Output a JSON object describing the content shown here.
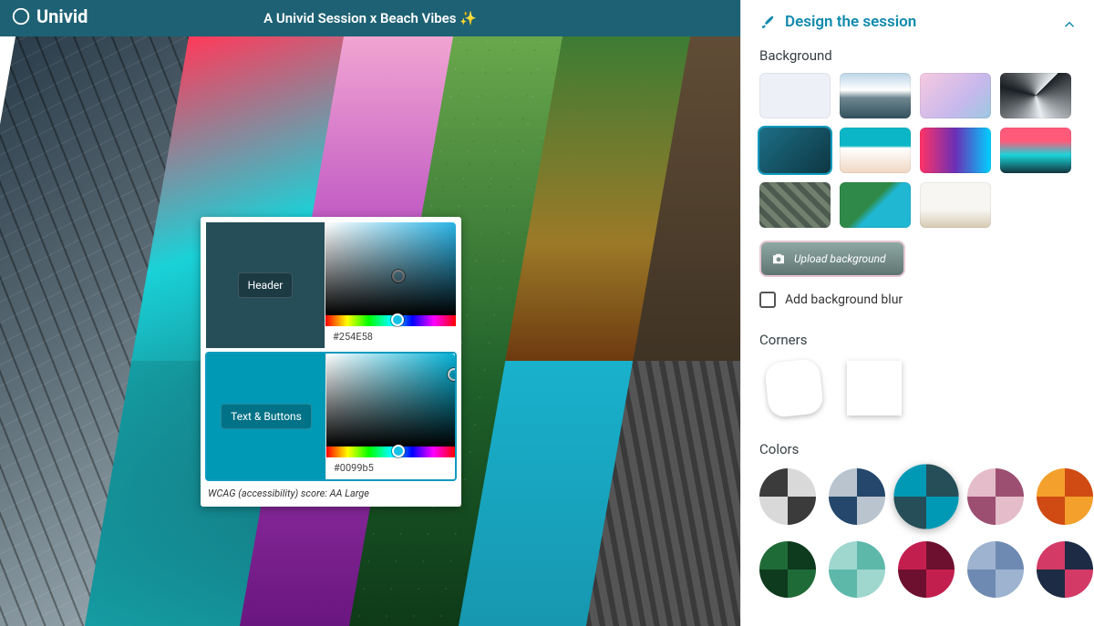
{
  "brand": "Univid",
  "header": {
    "title": "A Univid Session x Beach Vibes ✨"
  },
  "colorPicker": {
    "header": {
      "label": "Header",
      "hex": "#254E58",
      "swatch": "#254E58"
    },
    "textButtons": {
      "label": "Text & Buttons",
      "hex": "#0099b5",
      "swatch": "#0099b5"
    },
    "wcag": "WCAG (accessibility) score: AA Large"
  },
  "side": {
    "title": "Design the session",
    "background": {
      "title": "Background",
      "thumbs": [
        {
          "id": "plain",
          "style": "background:#edf1f7"
        },
        {
          "id": "mountain",
          "style": "background:linear-gradient(180deg,#bcd4e6 0%,#fff 38%,#6e8790 55%,#32505c 100%)"
        },
        {
          "id": "pastel",
          "style": "background:linear-gradient(135deg,#f7c9e0 0%,#c8b8ec 60%,#9ac8e0 100%)"
        },
        {
          "id": "geo",
          "style": "background:conic-gradient(from 45deg,#1a1f24,#e9eef2,#1a1f24,#e9eef2)"
        },
        {
          "id": "teal",
          "style": "background:linear-gradient(135deg,#1d6f86,#0d3642)",
          "selected": true
        },
        {
          "id": "beach",
          "style": "background:linear-gradient(180deg,#0bb6c6 40%,#fff 45%,#f0d7c3 100%)"
        },
        {
          "id": "neon",
          "style": "background:linear-gradient(90deg,#ff3366,#6a2fb5,#00d1ff)"
        },
        {
          "id": "city",
          "style": "background:linear-gradient(180deg,#ff5a7a 30%,#1bd4d9 60%,#12343e 100%)"
        },
        {
          "id": "highway",
          "style": "background:repeating-linear-gradient(45deg,#4d5a50 0 6px,#71806e 6px 12px)"
        },
        {
          "id": "diag",
          "style": "background:linear-gradient(135deg,#2f8a4a 45%,#1fb7d2 55%)"
        },
        {
          "id": "desk",
          "style": "background:linear-gradient(180deg,#f8f6f2 60%,#d7cab2 100%)"
        }
      ],
      "uploadLabel": "Upload background",
      "blurLabel": "Add background blur"
    },
    "corners": {
      "title": "Corners"
    },
    "colors": {
      "title": "Colors",
      "palettes": [
        {
          "q": [
            "#3b3b3b",
            "#d9d9d9",
            "#d9d9d9",
            "#3b3b3b"
          ]
        },
        {
          "q": [
            "#b9c4cf",
            "#24476b",
            "#24476b",
            "#b9c4cf"
          ]
        },
        {
          "q": [
            "#0099b5",
            "#254e58",
            "#254e58",
            "#0099b5"
          ],
          "selected": true
        },
        {
          "q": [
            "#e4bcca",
            "#9d4f72",
            "#9d4f72",
            "#e4bcca"
          ]
        },
        {
          "q": [
            "#f3a02c",
            "#cf4b13",
            "#cf4b13",
            "#f3a02c"
          ]
        },
        {
          "q": [
            "#1f6b37",
            "#0e3a1e",
            "#0e3a1e",
            "#1f6b37"
          ]
        },
        {
          "q": [
            "#9fd7cf",
            "#5eb8aa",
            "#5eb8aa",
            "#9fd7cf"
          ]
        },
        {
          "q": [
            "#c21f4f",
            "#6d1030",
            "#6d1030",
            "#c21f4f"
          ]
        },
        {
          "q": [
            "#9eb3d0",
            "#6f8ab2",
            "#6f8ab2",
            "#9eb3d0"
          ]
        },
        {
          "q": [
            "#d33a66",
            "#1d2b45",
            "#1d2b45",
            "#d33a66"
          ]
        }
      ]
    }
  }
}
